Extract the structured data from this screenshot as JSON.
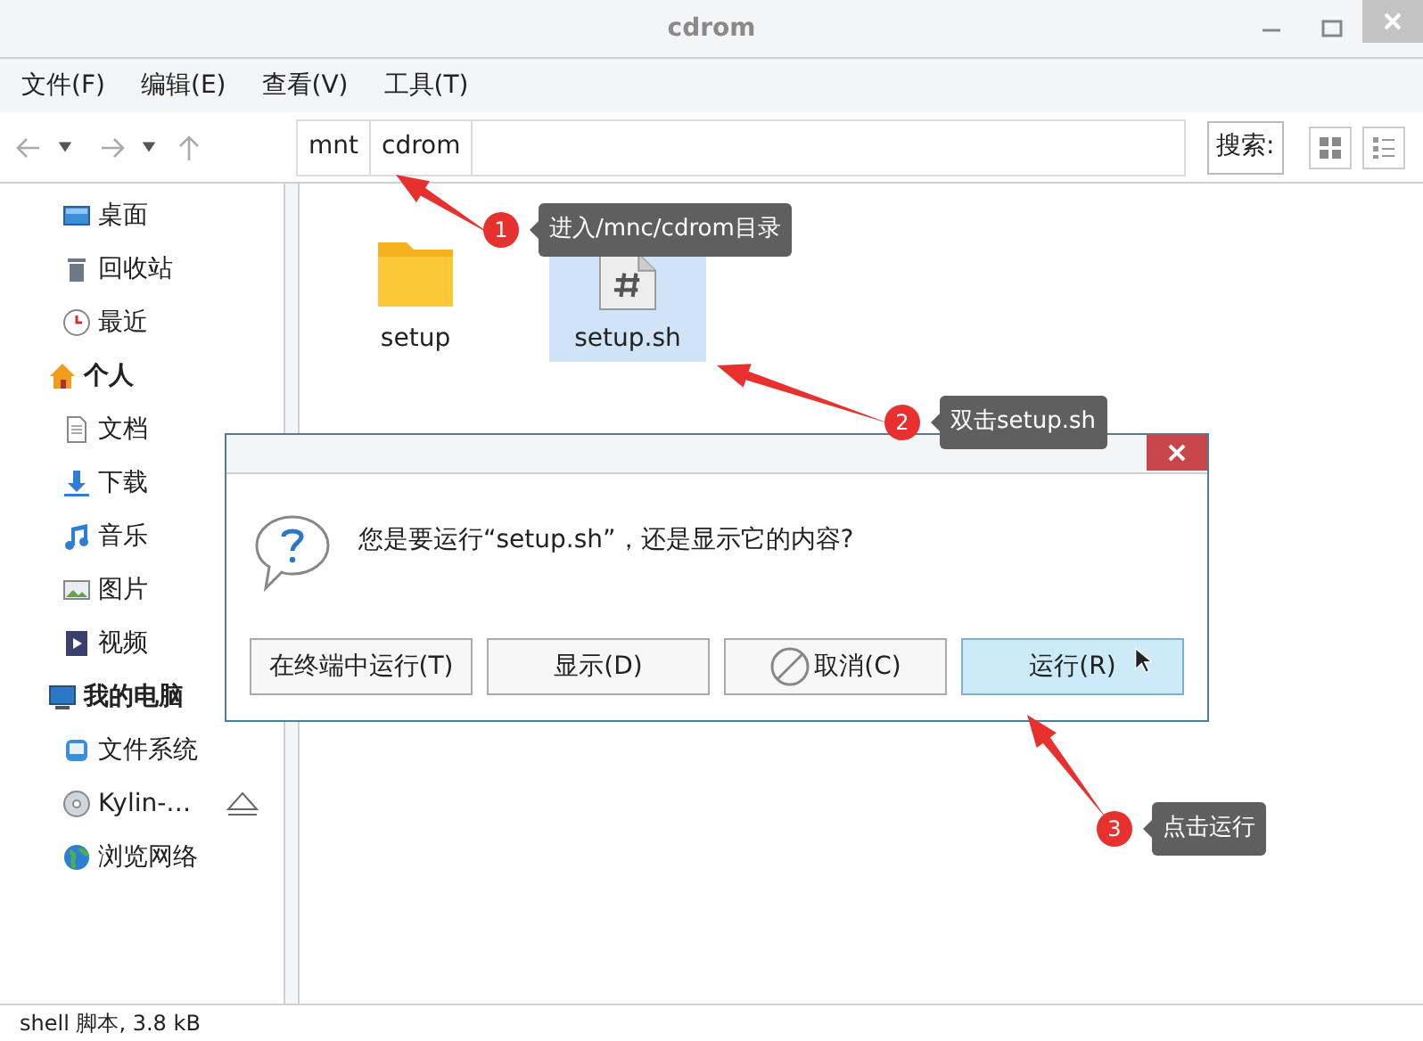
{
  "window": {
    "title": "cdrom"
  },
  "menu": [
    "文件(F)",
    "编辑(E)",
    "查看(V)",
    "工具(T)"
  ],
  "path": [
    "mnt",
    "cdrom"
  ],
  "search_label": "搜索:",
  "sidebar": [
    {
      "kind": "place",
      "label": "桌面"
    },
    {
      "kind": "place",
      "label": "回收站"
    },
    {
      "kind": "place",
      "label": "最近"
    },
    {
      "kind": "section",
      "label": "个人",
      "children": [
        {
          "kind": "place",
          "label": "文档"
        },
        {
          "kind": "place",
          "label": "下载"
        },
        {
          "kind": "place",
          "label": "音乐"
        },
        {
          "kind": "place",
          "label": "图片"
        },
        {
          "kind": "place",
          "label": "视频"
        }
      ]
    },
    {
      "kind": "section",
      "label": "我的电脑",
      "children": [
        {
          "kind": "place",
          "label": "文件系统"
        },
        {
          "kind": "drive",
          "label": "Kylin-…"
        },
        {
          "kind": "place",
          "label": "浏览网络"
        }
      ]
    }
  ],
  "files": [
    {
      "kind": "folder",
      "name": "setup",
      "selected": false
    },
    {
      "kind": "script",
      "name": "setup.sh",
      "selected": true
    }
  ],
  "status_bar": "shell 脚本, 3.8 kB",
  "dialog": {
    "message": "您是要运行“setup.sh”，还是显示它的内容?",
    "buttons": [
      {
        "kind": "plain",
        "label": "在终端中运行(T)",
        "selected": false
      },
      {
        "kind": "plain",
        "label": "显示(D)",
        "selected": false
      },
      {
        "kind": "cancel",
        "label": "取消(C)",
        "selected": false
      },
      {
        "kind": "plain",
        "label": "运行(R)",
        "selected": true
      }
    ]
  },
  "annotations": [
    {
      "number": "1",
      "text": "进入/mnc/cdrom目录"
    },
    {
      "number": "2",
      "text": "双击setup.sh"
    },
    {
      "number": "3",
      "text": "点击运行"
    }
  ]
}
